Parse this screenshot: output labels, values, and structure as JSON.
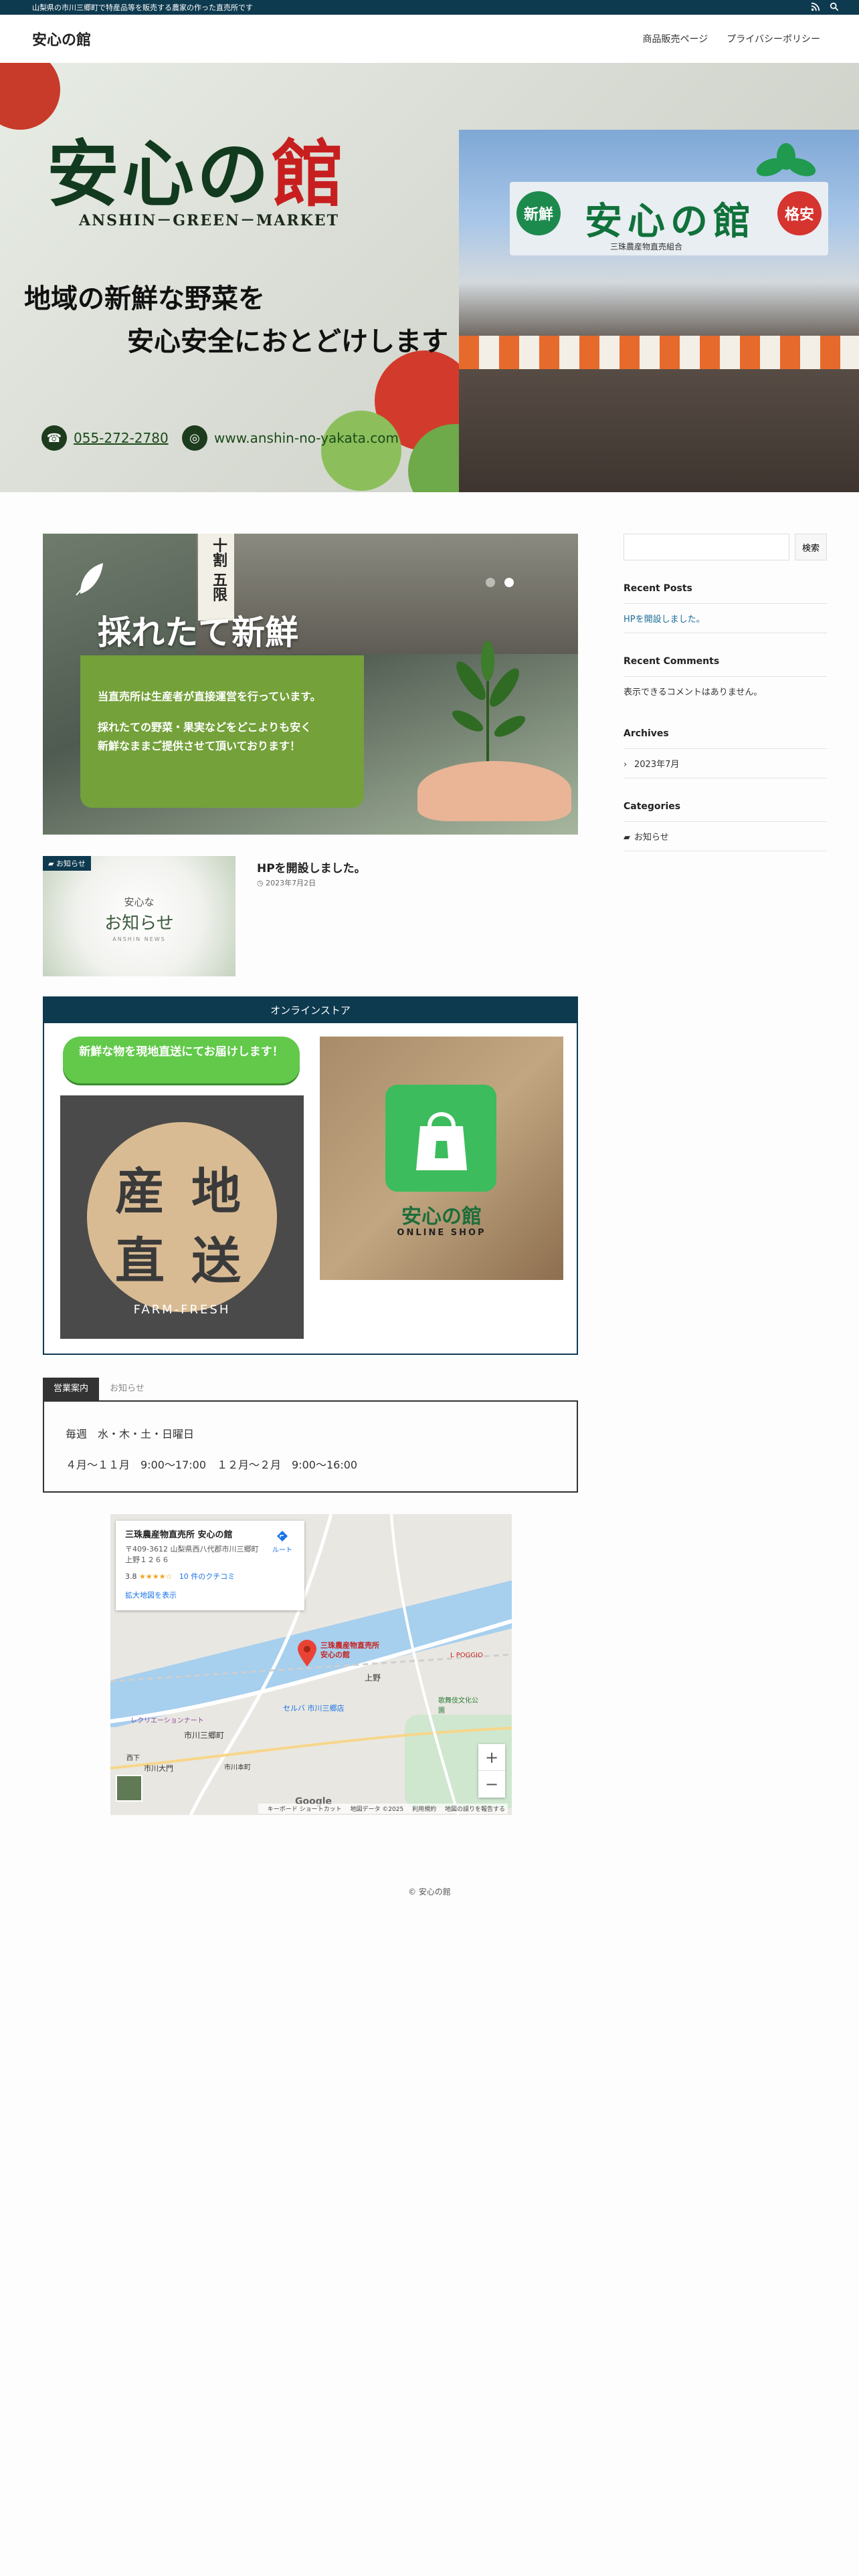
{
  "topbar": {
    "tagline": "山梨県の市川三郷町で特産品等を販売する農家の作った直売所です",
    "icons": [
      "rss-icon",
      "search-icon"
    ]
  },
  "header": {
    "site_title": "安心の館",
    "nav": [
      "商品販売ページ",
      "プライバシーポリシー"
    ]
  },
  "hero": {
    "title_main": "安心の",
    "title_accent": "館",
    "subtitle": "ANSHIN－GREEN－MARKET",
    "copy_line1": "地域の新鮮な野菜を",
    "copy_line2": "安心安全におとどけします",
    "phone": "055-272-2780",
    "website": "www.anshin-no-yakata.com",
    "sign_text": "安心の館",
    "sign_badge_left": "新鮮",
    "sign_badge_right": "格安",
    "sign_caption": "三珠農産物直売組合"
  },
  "slider": {
    "kanban": "十割 五限",
    "headline": "採れたて新鮮",
    "text1": "当直売所は生産者が直接運営を行っています。",
    "text2": "採れたての野菜・果実などをどこよりも安く",
    "text3": "新鮮なままご提供させて頂いております！",
    "dots": 2,
    "active_dot": 1
  },
  "post": {
    "category": "お知らせ",
    "thumb_small": "安心な",
    "thumb_big": "お知らせ",
    "thumb_en": "ANSHIN NEWS",
    "title": "HPを開設しました。",
    "date": "2023年7月2日"
  },
  "store": {
    "header": "オンラインストア",
    "button": "新鮮な物を現地直送にてお届けします！",
    "farm_chars": [
      "産",
      "地",
      "直",
      "送"
    ],
    "farm_en": "FARM-FRESH",
    "shop_name": "安心の館",
    "shop_sub": "ONLINE SHOP"
  },
  "tabs": {
    "items": [
      "営業案内",
      "お知らせ"
    ],
    "active": 0,
    "line1": "毎週　水・木・土・日曜日",
    "line2": "４月～１１月　9:00～17:00　１２月～２月　9:00～16:00"
  },
  "map": {
    "place_name": "三珠農産物直売所 安心の館",
    "address": "〒409-3612 山梨県西八代郡市川三郷町上野１２６６",
    "rating": "3.8",
    "stars": "★★★★☆",
    "reviews": "10 件のクチコミ",
    "directions": "ルート",
    "larger_map": "拡大地図を表示",
    "pin_label": "三珠農産物直売所 安心の館",
    "zoom_in": "+",
    "zoom_out": "−",
    "google": "Google",
    "attr": [
      "キーボード ショートカット",
      "地図データ ©2025",
      "利用規約",
      "地図の誤りを報告する"
    ],
    "places": [
      "市川三郷町",
      "上野",
      "市川大門",
      "セルバ 市川三郷店",
      "歌舞伎文化公園",
      "L POGGIO",
      "レクリエーションナート",
      "西下",
      "市川本町"
    ]
  },
  "sidebar": {
    "search_placeholder": "",
    "search_button": "検索",
    "recent_posts_title": "Recent Posts",
    "recent_posts": [
      "HPを開設しました。"
    ],
    "recent_comments_title": "Recent Comments",
    "recent_comments_empty": "表示できるコメントはありません。",
    "archives_title": "Archives",
    "archives": [
      "2023年7月"
    ],
    "categories_title": "Categories",
    "categories": [
      "お知らせ"
    ]
  },
  "footer": {
    "copyright": "© 安心の館"
  },
  "colors": {
    "brand_navy": "#0e3a4f",
    "accent_green": "#62c94a",
    "sign_green": "#10713a",
    "accent_red": "#c71f1f"
  }
}
